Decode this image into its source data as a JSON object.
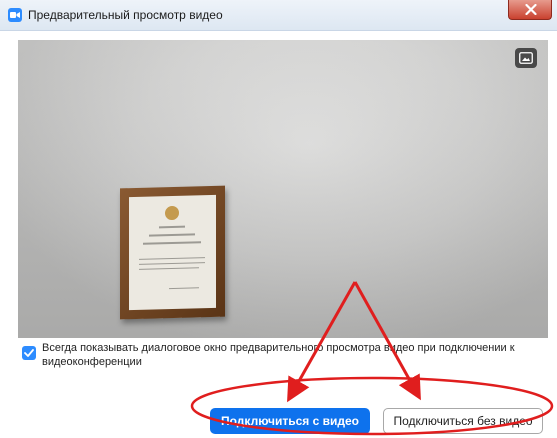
{
  "window": {
    "title": "Предварительный просмотр видео",
    "app_icon": "zoom-camera-icon",
    "close_icon": "close-icon"
  },
  "video_preview": {
    "pip_icon": "picture-in-picture-icon"
  },
  "option": {
    "checked": true,
    "label": "Всегда показывать диалоговое окно предварительного просмотра видео при подключении к видеоконференции"
  },
  "buttons": {
    "join_with_video": "Подключиться с видео",
    "join_without_video": "Подключиться без видео"
  },
  "colors": {
    "accent": "#0e72ed",
    "checkbox": "#2d8cff",
    "annotation_red": "#e01e1e"
  }
}
